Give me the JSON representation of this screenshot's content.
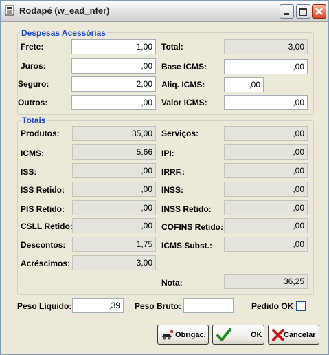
{
  "window": {
    "title": "Rodapé (w_ead_nfer)"
  },
  "despesas": {
    "title": "Despesas Acessórias",
    "frete": {
      "label": "Frete:",
      "value": "1,00"
    },
    "juros": {
      "label": "Juros:",
      "value": ",00"
    },
    "seguro": {
      "label": "Seguro:",
      "value": "2,00"
    },
    "outros": {
      "label": "Outros:",
      "value": ",00"
    },
    "total": {
      "label": "Total:",
      "value": "3,00"
    },
    "base_icms": {
      "label": "Base ICMS:",
      "value": ",00"
    },
    "aliq_icms": {
      "label": "Aliq. ICMS:",
      "value": ",00"
    },
    "valor_icms": {
      "label": "Valor ICMS:",
      "value": ",00"
    }
  },
  "totais": {
    "title": "Totais",
    "produtos": {
      "label": "Produtos:",
      "value": "35,00"
    },
    "icms": {
      "label": "ICMS:",
      "value": "5,66"
    },
    "iss": {
      "label": "ISS:",
      "value": ",00"
    },
    "iss_retido": {
      "label": "ISS Retido:",
      "value": ",00"
    },
    "pis_retido": {
      "label": "PIS Retido:",
      "value": ",00"
    },
    "csll_retido": {
      "label": "CSLL Retido:",
      "value": ",00"
    },
    "descontos": {
      "label": "Descontos:",
      "value": "1,75"
    },
    "acrescimos": {
      "label": "Acréscimos:",
      "value": "3,00"
    },
    "servicos": {
      "label": "Serviços:",
      "value": ",00"
    },
    "ipi": {
      "label": "IPI:",
      "value": ",00"
    },
    "irrf": {
      "label": "IRRF.:",
      "value": ",00"
    },
    "inss": {
      "label": "INSS:",
      "value": ",00"
    },
    "inss_retido": {
      "label": "INSS Retido:",
      "value": ",00"
    },
    "cofins_retido": {
      "label": "COFINS Retido:",
      "value": ",00"
    },
    "icms_subst": {
      "label": "ICMS Subst.:",
      "value": ",00"
    },
    "nota": {
      "label": "Nota:",
      "value": "36,25"
    }
  },
  "footer": {
    "peso_liquido": {
      "label": "Peso Líquido:",
      "value": ",39"
    },
    "peso_bruto": {
      "label": "Peso Bruto:",
      "value": ","
    },
    "pedido_ok": {
      "label": "Pedido OK",
      "checked": false
    }
  },
  "buttons": {
    "obrigac": "Obrigac.",
    "ok": "OK",
    "cancelar": "Cancelar"
  },
  "colors": {
    "group_title": "#1b47c8",
    "background": "#ece9d8"
  }
}
